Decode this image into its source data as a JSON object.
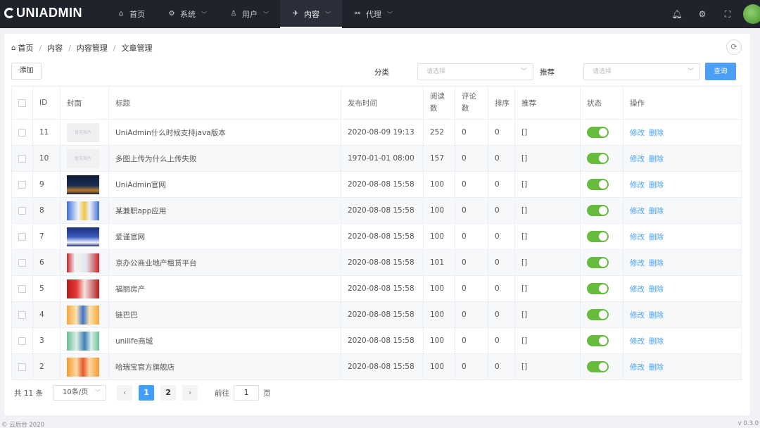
{
  "app": {
    "logo_text": "UNIADMIN"
  },
  "nav": [
    {
      "label": "首页",
      "icon": "home-icon",
      "glyph": "⌂",
      "dropdown": false,
      "active": false
    },
    {
      "label": "系统",
      "icon": "gear-icon",
      "glyph": "⚙",
      "dropdown": true,
      "active": false
    },
    {
      "label": "用户",
      "icon": "user-icon",
      "glyph": "♙",
      "dropdown": true,
      "active": false
    },
    {
      "label": "内容",
      "icon": "send-icon",
      "glyph": "✈",
      "dropdown": true,
      "active": true
    },
    {
      "label": "代理",
      "icon": "agent-icon",
      "glyph": "⚯",
      "dropdown": true,
      "active": false
    }
  ],
  "header_icons": [
    "bell-icon",
    "settings-icon",
    "fullscreen-icon"
  ],
  "breadcrumb": [
    "首页",
    "内容",
    "内容管理",
    "文章管理"
  ],
  "toolbar": {
    "add_label": "添加",
    "query_label": "查询"
  },
  "filters": {
    "category_label": "分类",
    "category_placeholder": "请选择",
    "recommend_label": "推荐",
    "recommend_placeholder": "请选择"
  },
  "table": {
    "headers": {
      "id": "ID",
      "cover": "封面",
      "title": "标题",
      "time": "发布时间",
      "reads_a": "阅读",
      "reads_b": "数",
      "comments_a": "评论",
      "comments_b": "数",
      "sort": "排序",
      "recommend": "推荐",
      "status": "状态",
      "ops": "操作"
    },
    "no_image_text": "暂无图片",
    "edit_label": "修改",
    "delete_label": "删除",
    "rows": [
      {
        "id": "11",
        "cover": "none",
        "title": "UniAdmin什么时候支持java版本",
        "time": "2020-08-09 19:13",
        "reads": "252",
        "comments": "0",
        "sort": "0",
        "recommend": "[]",
        "enabled": true
      },
      {
        "id": "10",
        "cover": "none",
        "title": "多图上传为什么上传失败",
        "time": "1970-01-01 08:00",
        "reads": "157",
        "comments": "0",
        "sort": "0",
        "recommend": "[]",
        "enabled": true
      },
      {
        "id": "9",
        "cover": "dark",
        "title": "UniAdmin官网",
        "time": "2020-08-08 15:58",
        "reads": "100",
        "comments": "0",
        "sort": "0",
        "recommend": "[]",
        "enabled": true
      },
      {
        "id": "8",
        "cover": "blue",
        "title": "某兼职app应用",
        "time": "2020-08-08 15:58",
        "reads": "100",
        "comments": "0",
        "sort": "0",
        "recommend": "[]",
        "enabled": true
      },
      {
        "id": "7",
        "cover": "navy",
        "title": "爱谨官网",
        "time": "2020-08-08 15:58",
        "reads": "100",
        "comments": "0",
        "sort": "0",
        "recommend": "[]",
        "enabled": true
      },
      {
        "id": "6",
        "cover": "red",
        "title": "京办公商业地产租赁平台",
        "time": "2020-08-08 15:58",
        "reads": "101",
        "comments": "0",
        "sort": "0",
        "recommend": "[]",
        "enabled": true
      },
      {
        "id": "5",
        "cover": "crimson",
        "title": "福丽房产",
        "time": "2020-08-08 15:58",
        "reads": "100",
        "comments": "0",
        "sort": "0",
        "recommend": "[]",
        "enabled": true
      },
      {
        "id": "4",
        "cover": "orange",
        "title": "链巴巴",
        "time": "2020-08-08 15:58",
        "reads": "100",
        "comments": "0",
        "sort": "0",
        "recommend": "[]",
        "enabled": true
      },
      {
        "id": "3",
        "cover": "green",
        "title": "unilife商城",
        "time": "2020-08-08 15:58",
        "reads": "100",
        "comments": "0",
        "sort": "0",
        "recommend": "[]",
        "enabled": true
      },
      {
        "id": "2",
        "cover": "amber",
        "title": "哈瑞宝官方旗舰店",
        "time": "2020-08-08 15:58",
        "reads": "100",
        "comments": "0",
        "sort": "0",
        "recommend": "[]",
        "enabled": true
      }
    ]
  },
  "pagination": {
    "total_text": "共 11 条",
    "page_size": "10条/页",
    "pages": [
      "1",
      "2"
    ],
    "current": "1",
    "goto_label": "前往",
    "goto_value": "1",
    "page_suffix": "页"
  },
  "footer": {
    "left": "© 云后台 2020",
    "right": "v 0.3.0"
  },
  "colors": {
    "topbar": "#20232b",
    "accent": "#409eff",
    "switch_on": "#67bb3d"
  }
}
